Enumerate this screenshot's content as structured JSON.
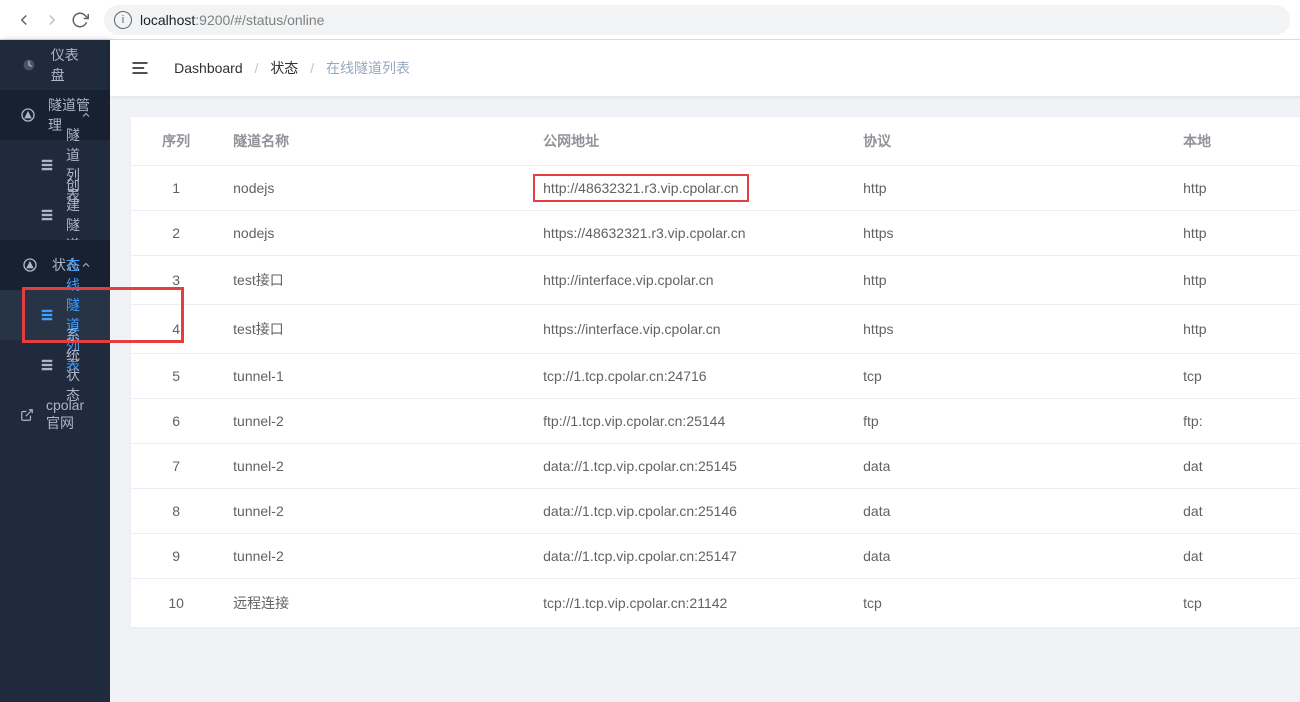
{
  "browser": {
    "url_host": "localhost",
    "url_path": ":9200/#/status/online"
  },
  "sidebar": {
    "dashboard": "仪表盘",
    "tunnel_mgmt": "隧道管理",
    "tunnel_list": "隧道列表",
    "create_tunnel": "创建隧道",
    "status": "状态",
    "online_list": "在线隧道列表",
    "system_status": "系统状态",
    "cpolar_site": "cpolar官网"
  },
  "breadcrumb": {
    "dashboard": "Dashboard",
    "status": "状态",
    "current": "在线隧道列表"
  },
  "table": {
    "headers": {
      "seq": "序列",
      "name": "隧道名称",
      "url": "公网地址",
      "proto": "协议",
      "local": "本地"
    },
    "rows": [
      {
        "seq": "1",
        "name": "nodejs",
        "url": "http://48632321.r3.vip.cpolar.cn",
        "proto": "http",
        "local": "http",
        "highlight_url": true
      },
      {
        "seq": "2",
        "name": "nodejs",
        "url": "https://48632321.r3.vip.cpolar.cn",
        "proto": "https",
        "local": "http"
      },
      {
        "seq": "3",
        "name": "test接口",
        "url": "http://interface.vip.cpolar.cn",
        "proto": "http",
        "local": "http"
      },
      {
        "seq": "4",
        "name": "test接口",
        "url": "https://interface.vip.cpolar.cn",
        "proto": "https",
        "local": "http"
      },
      {
        "seq": "5",
        "name": "tunnel-1",
        "url": "tcp://1.tcp.cpolar.cn:24716",
        "proto": "tcp",
        "local": "tcp"
      },
      {
        "seq": "6",
        "name": "tunnel-2",
        "url": "ftp://1.tcp.vip.cpolar.cn:25144",
        "proto": "ftp",
        "local": "ftp:"
      },
      {
        "seq": "7",
        "name": "tunnel-2",
        "url": "data://1.tcp.vip.cpolar.cn:25145",
        "proto": "data",
        "local": "dat"
      },
      {
        "seq": "8",
        "name": "tunnel-2",
        "url": "data://1.tcp.vip.cpolar.cn:25146",
        "proto": "data",
        "local": "dat"
      },
      {
        "seq": "9",
        "name": "tunnel-2",
        "url": "data://1.tcp.vip.cpolar.cn:25147",
        "proto": "data",
        "local": "dat"
      },
      {
        "seq": "10",
        "name": "远程连接",
        "url": "tcp://1.tcp.vip.cpolar.cn:21142",
        "proto": "tcp",
        "local": "tcp"
      }
    ]
  }
}
